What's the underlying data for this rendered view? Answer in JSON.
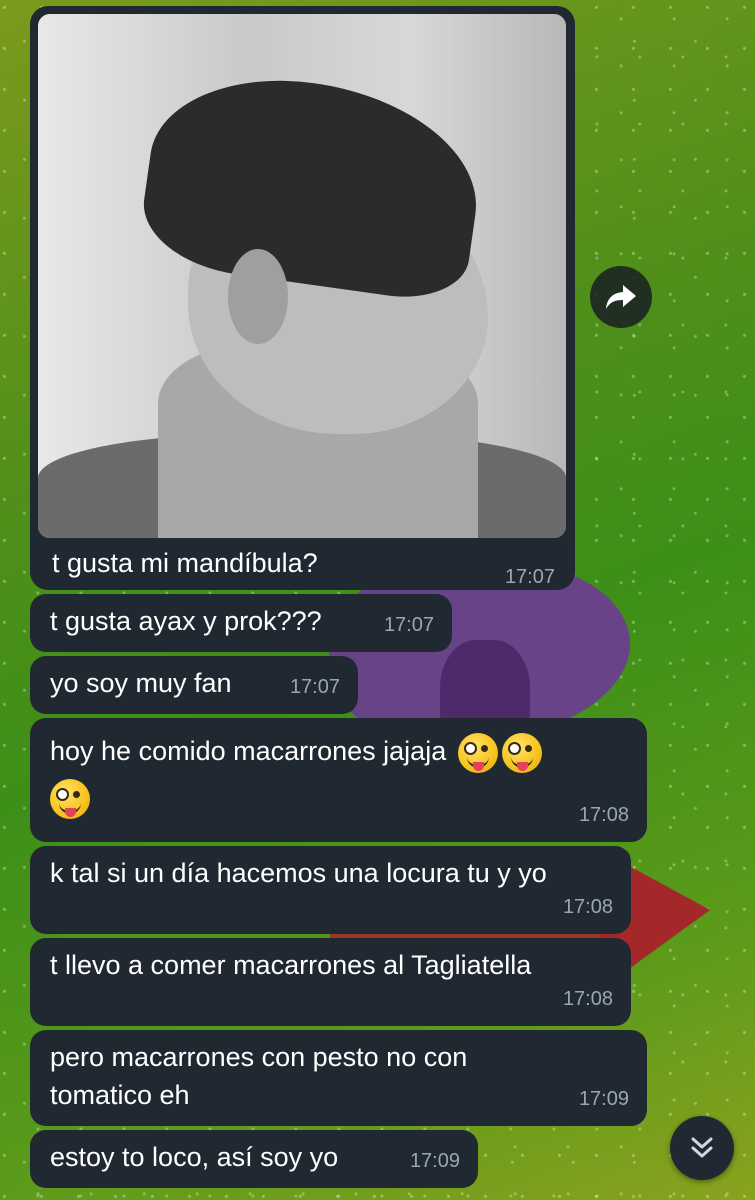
{
  "chat": {
    "photo_message": {
      "caption": "t gusta mi mandíbula?",
      "time": "17:07"
    },
    "messages": [
      {
        "text": "t gusta ayax y prok???",
        "time": "17:07"
      },
      {
        "text": "yo soy muy fan",
        "time": "17:07"
      },
      {
        "text": "hoy he comido macarrones jajaja",
        "time": "17:08",
        "emojis": [
          "zany-face",
          "zany-face",
          "zany-face"
        ]
      },
      {
        "text": "k tal si un día hacemos una locura tu y yo",
        "time": "17:08"
      },
      {
        "text": "t llevo a comer macarrones al Tagliatella",
        "time": "17:08"
      },
      {
        "text": "pero macarrones con pesto no con",
        "text2": "tomatico eh",
        "time": "17:09"
      },
      {
        "text": "estoy to loco, así soy yo",
        "time": "17:09"
      }
    ]
  },
  "icons": {
    "forward": "forward-arrow-icon",
    "scroll_down": "double-chevron-down-icon"
  },
  "colors": {
    "bubble": "#202932",
    "timestamp": "#9aa6b2",
    "text": "#ffffff"
  }
}
